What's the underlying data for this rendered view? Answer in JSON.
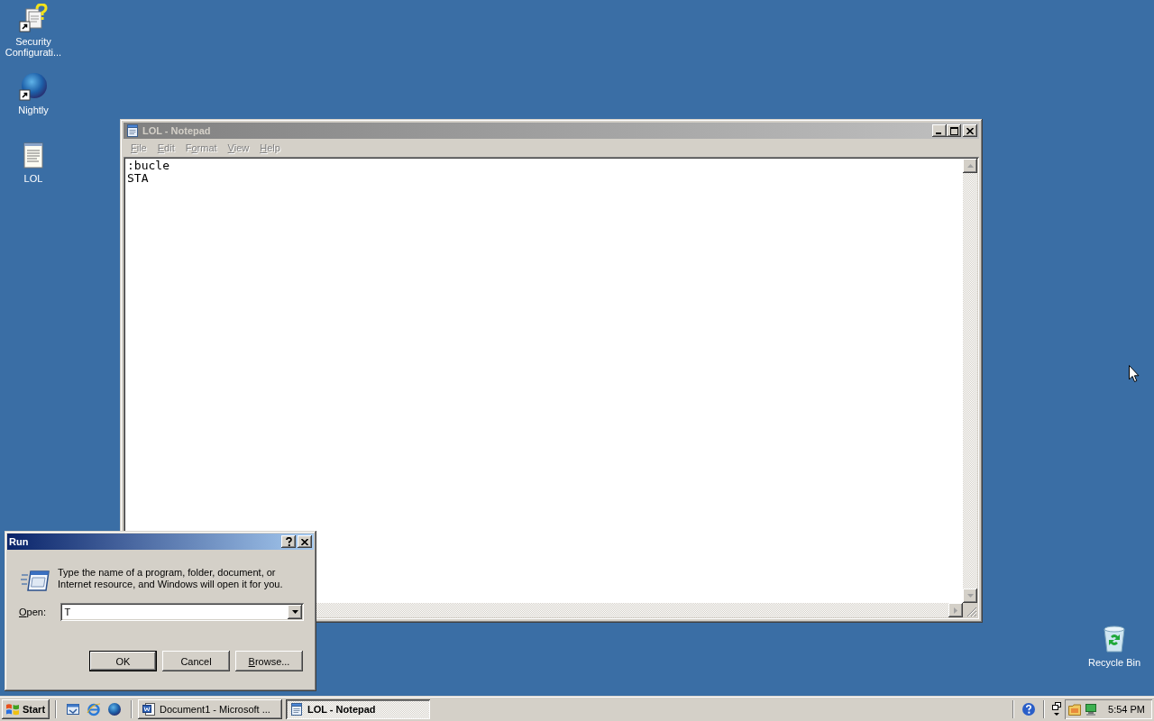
{
  "desktop_icons": [
    {
      "label": "Security Configurati...",
      "kind": "security_shortcut"
    },
    {
      "label": "Nightly",
      "kind": "globe_shortcut"
    },
    {
      "label": "LOL",
      "kind": "text_file"
    }
  ],
  "notepad": {
    "title": "LOL - Notepad",
    "active": false,
    "menu": [
      {
        "key": "F",
        "after": "ile",
        "disabled": true
      },
      {
        "key": "E",
        "after": "dit",
        "disabled": true
      },
      {
        "before": "F",
        "key": "o",
        "after": "rmat",
        "disabled": true
      },
      {
        "key": "V",
        "after": "iew",
        "disabled": true
      },
      {
        "key": "H",
        "after": "elp",
        "disabled": true
      }
    ],
    "lines": [
      ":bucle",
      "STA"
    ]
  },
  "run_dialog": {
    "title": "Run",
    "active": true,
    "description": "Type the name of a program, folder, document, or Internet resource, and Windows will open it for you.",
    "open_label": {
      "key": "O",
      "after": "pen:"
    },
    "value": "T",
    "buttons": [
      {
        "label": "OK",
        "default": true
      },
      {
        "label": "Cancel",
        "default": false
      },
      {
        "key": "B",
        "after": "rowse...",
        "default": false
      }
    ]
  },
  "recycle_bin": {
    "label": "Recycle Bin"
  },
  "taskbar": {
    "start": "Start",
    "tasks": [
      {
        "label": "Document1 - Microsoft ...",
        "kind": "document",
        "selected": false
      },
      {
        "label": "LOL - Notepad",
        "kind": "notepad",
        "selected": true
      }
    ],
    "clock": "5:54 PM"
  }
}
